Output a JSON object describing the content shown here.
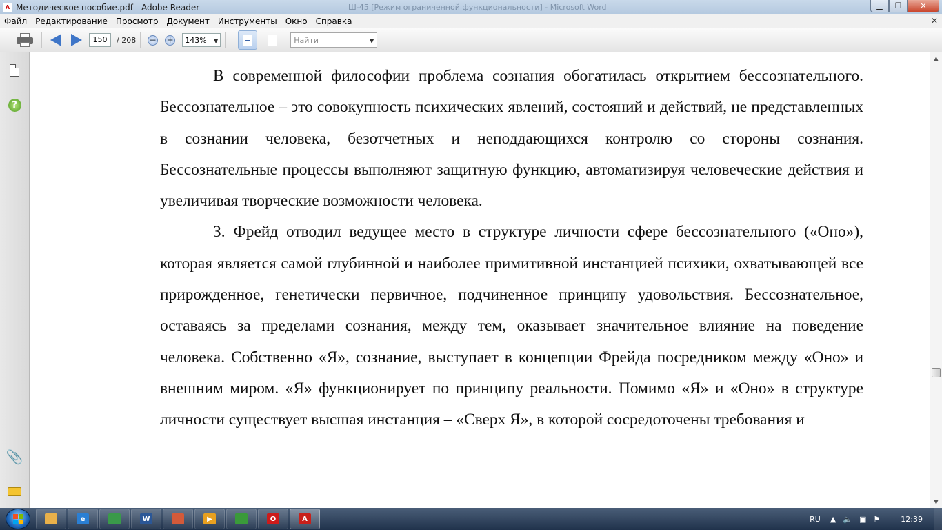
{
  "window": {
    "title": "Методическое пособие.pdf - Adobe Reader",
    "ghost_title": "Ш-45 [Режим ограниченной функциональности] - Microsoft Word",
    "pdf_mark": "A"
  },
  "menu": {
    "items": [
      "Файл",
      "Редактирование",
      "Просмотр",
      "Документ",
      "Инструменты",
      "Окно",
      "Справка"
    ]
  },
  "toolbar": {
    "page_current": "150",
    "page_total": "/  208",
    "zoom": "143%",
    "zoom_out_glyph": "−",
    "zoom_in_glyph": "+",
    "find_placeholder": "Найти"
  },
  "document": {
    "paragraphs": [
      "В современной философии проблема сознания обогатилась открытием бессознательного. Бессознательное – это совокупность психических явлений, состояний и действий, не представленных в сознании человека, безотчетных и неподдающихся контролю со стороны сознания. Бессознательные процессы выполняют защитную функцию, автоматизируя человеческие действия и увеличивая творческие возможности человека.",
      "З. Фрейд отводил ведущее место в структуре личности сфере бессознательного («Оно»), которая является самой глубинной и наиболее примитивной инстанцией психики, охватывающей все прирожденное, генетически первичное, подчиненное принципу удовольствия. Бессознательное, оставаясь за пределами сознания, между тем, оказывает значительное влияние на поведение человека. Собственно «Я», сознание, выступает в концепции Фрейда посредником между «Оно» и внешним миром. «Я» функционирует по принципу реальности. Помимо «Я» и «Оно» в структуре личности существует высшая инстанция – «Сверх Я», в которой сосредоточены требования и"
    ]
  },
  "taskbar": {
    "apps": [
      {
        "name": "explorer",
        "label": "",
        "color": "#e8b04a"
      },
      {
        "name": "internet-explorer",
        "label": "e",
        "color": "#2a7fd4"
      },
      {
        "name": "media-app",
        "label": "",
        "color": "#3a9a4a"
      },
      {
        "name": "word",
        "label": "W",
        "color": "#2b5797"
      },
      {
        "name": "app-red",
        "label": "",
        "color": "#d35a3a"
      },
      {
        "name": "media-player",
        "label": "▶",
        "color": "#e8a020"
      },
      {
        "name": "chrome",
        "label": "",
        "color": "#3a9a3a"
      },
      {
        "name": "opera",
        "label": "O",
        "color": "#cc1b1b"
      },
      {
        "name": "adobe-reader",
        "label": "A",
        "color": "#c8201a"
      }
    ],
    "language": "RU",
    "clock": "12:39"
  }
}
